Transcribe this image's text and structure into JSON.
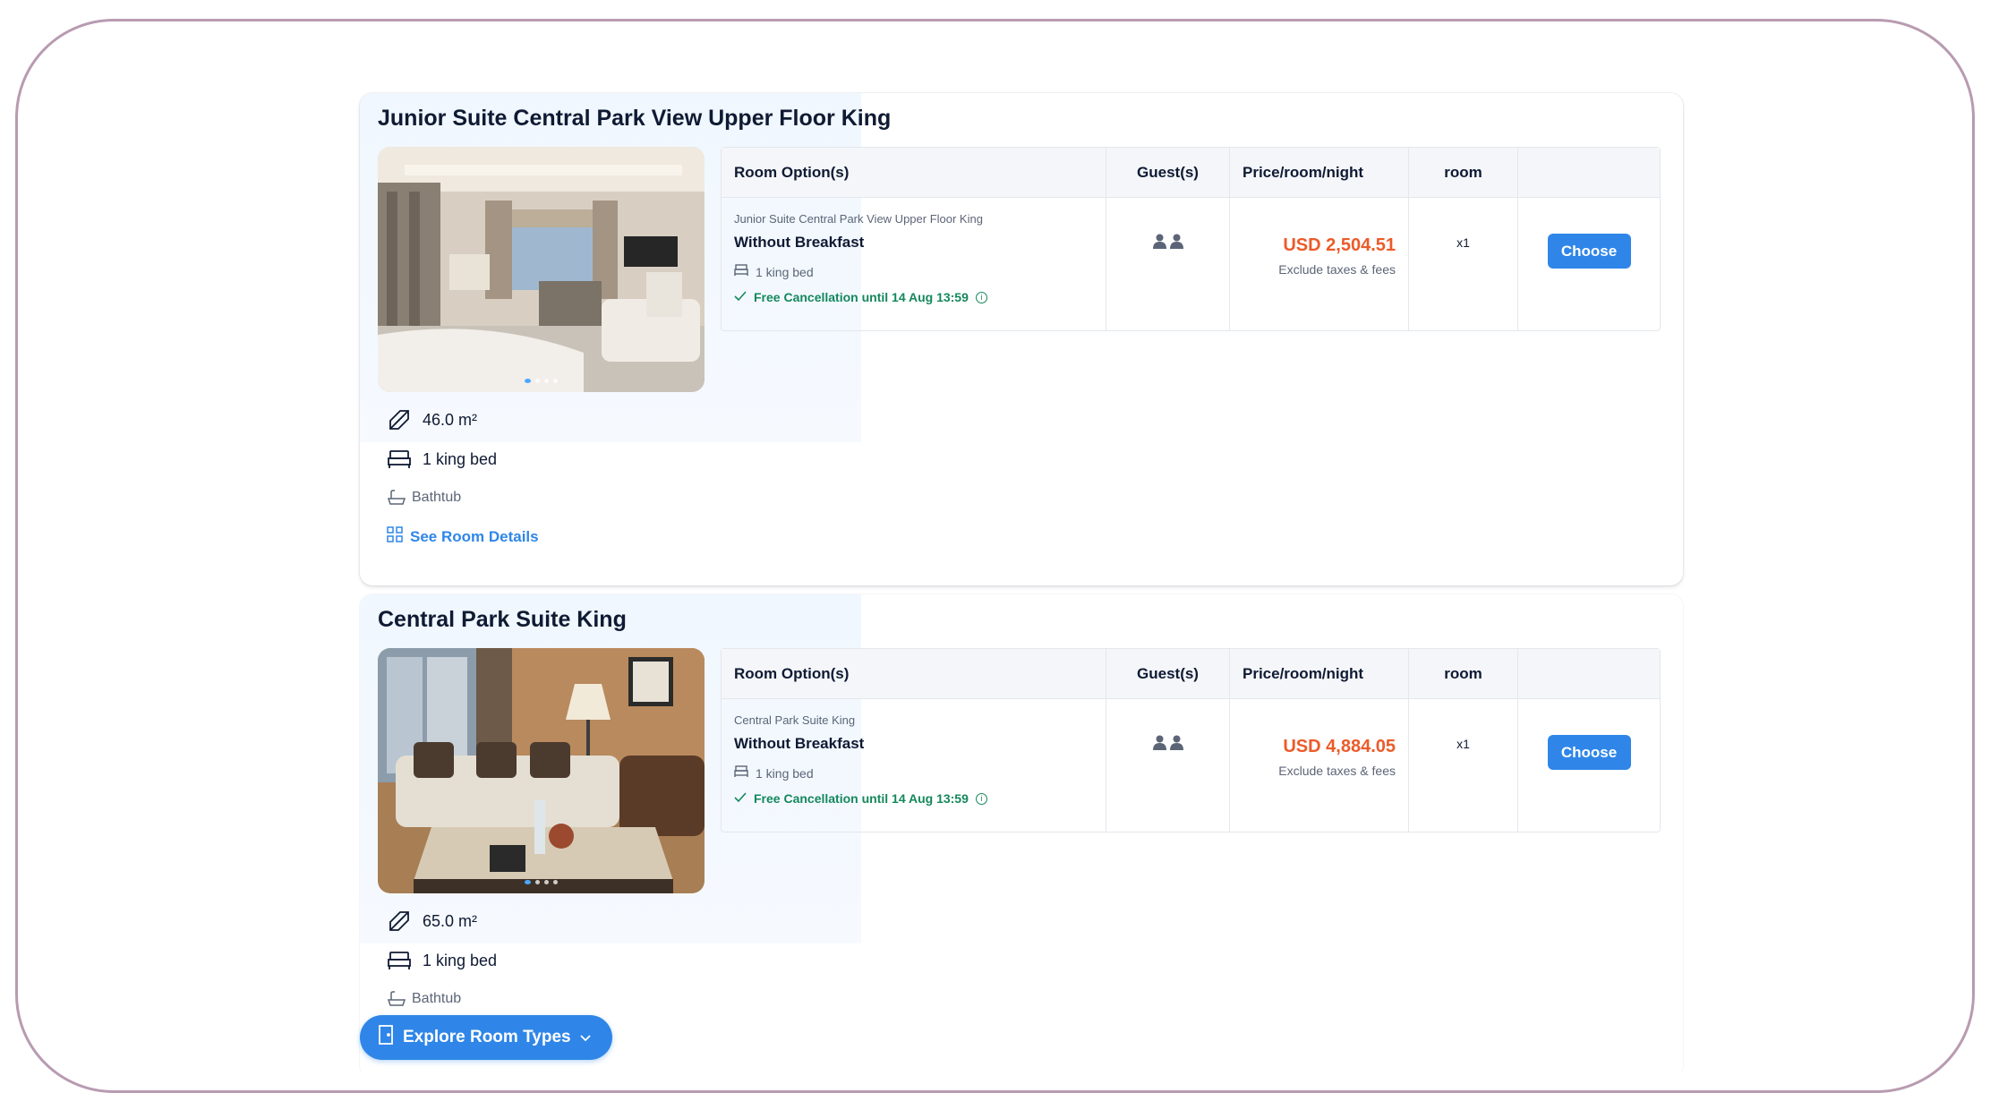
{
  "colors": {
    "accent": "#2f86e8",
    "price": "#eb5b2a",
    "cancel": "#14885c",
    "text": "#0f1a33",
    "muted": "#5c6577"
  },
  "table_headers": {
    "options": "Room Option(s)",
    "guests": "Guest(s)",
    "price": "Price/room/night",
    "room": "room"
  },
  "rooms": [
    {
      "title": "Junior Suite Central Park View Upper Floor King",
      "area": "46.0 m²",
      "bed": "1 king bed",
      "bath": "Bathtub",
      "see_details": "See Room Details",
      "option": {
        "subtitle": "Junior Suite Central Park View Upper Floor King",
        "name": "Without Breakfast",
        "bed": "1 king bed",
        "cancellation": "Free Cancellation until 14 Aug 13:59",
        "price": "USD 2,504.51",
        "price_note": "Exclude taxes & fees",
        "qty": "x1",
        "choose_label": "Choose"
      }
    },
    {
      "title": "Central Park Suite King",
      "area": "65.0 m²",
      "bed": "1 king bed",
      "bath": "Bathtub",
      "option": {
        "subtitle": "Central Park Suite King",
        "name": "Without Breakfast",
        "bed": "1 king bed",
        "cancellation": "Free Cancellation until 14 Aug 13:59",
        "price": "USD 4,884.05",
        "price_note": "Exclude taxes & fees",
        "qty": "x1",
        "choose_label": "Choose"
      }
    }
  ],
  "explore_label": "Explore Room Types",
  "icons": {
    "area": "area-icon",
    "bed": "bed-icon",
    "bath": "bathtub-icon",
    "details": "details-grid-icon",
    "guest": "person-icon",
    "check": "check-icon",
    "info": "info-icon",
    "door": "door-icon",
    "chevron": "chevron-down-icon"
  }
}
